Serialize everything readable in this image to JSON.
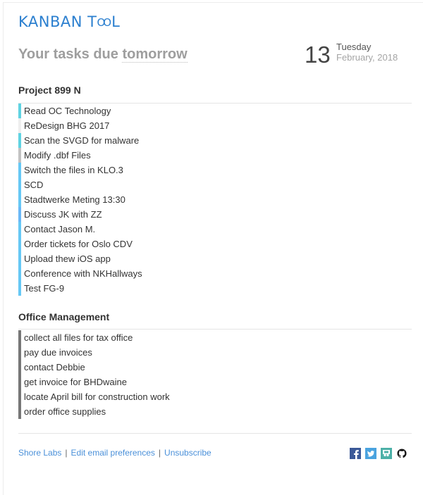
{
  "header": {
    "logo_text": "KANBAN TOOL",
    "logo_parts": [
      "KANBAN T",
      "OO",
      "L"
    ],
    "headline_prefix": "Your tasks due ",
    "headline_highlight": "tomorrow",
    "date_day_number": "13",
    "date_weekday": "Tuesday",
    "date_month_year": "February, 2018"
  },
  "sections": [
    {
      "title": "Project 899 N",
      "tasks": [
        {
          "label": "Read OC Technology",
          "color": "#5fd3e2"
        },
        {
          "label": "ReDesign BHG 2017",
          "color": "#eeeeee"
        },
        {
          "label": "Scan the SVGD for malware",
          "color": "#5fd3e2"
        },
        {
          "label": "Modify .dbf Files",
          "color": "#c2c2c2"
        },
        {
          "label": "Switch the files in KLO.3",
          "color": "#66c8f5"
        },
        {
          "label": "SCD",
          "color": "#66c8f5"
        },
        {
          "label": "Stadtwerke Meting 13:30",
          "color": "#66c8f5"
        },
        {
          "label": "Discuss JK with ZZ",
          "color": "#6ab8f7"
        },
        {
          "label": "Contact Jason M.",
          "color": "#66c8f5"
        },
        {
          "label": "Order tickets for Oslo CDV",
          "color": "#66c8f5"
        },
        {
          "label": "Upload thew iOS app",
          "color": "#66c8f5"
        },
        {
          "label": "Conference with NKHallways",
          "color": "#66c8f5"
        },
        {
          "label": "Test FG-9",
          "color": "#66c8f5"
        }
      ]
    },
    {
      "title": "Office Management",
      "tasks": [
        {
          "label": "collect all files for tax office",
          "color": "#777777"
        },
        {
          "label": "pay due invoices",
          "color": "#777777"
        },
        {
          "label": "contact Debbie",
          "color": "#777777"
        },
        {
          "label": "get invoice for BHDwaine",
          "color": "#777777"
        },
        {
          "label": "locate April bill for construction work",
          "color": "#777777"
        },
        {
          "label": "order office supplies",
          "color": "#777777"
        }
      ]
    }
  ],
  "footer": {
    "links": [
      "Shore Labs",
      "Edit email preferences",
      "Unsubscribe"
    ],
    "separator": "|",
    "social": [
      {
        "name": "facebook-icon",
        "glyph": "f",
        "color": "#3b5998"
      },
      {
        "name": "twitter-icon",
        "glyph": "t",
        "color": "#4aa3df"
      },
      {
        "name": "slideshare-icon",
        "glyph": "s",
        "color": "#4cb0a7"
      },
      {
        "name": "github-icon",
        "glyph": "",
        "color": "#111111"
      }
    ]
  }
}
